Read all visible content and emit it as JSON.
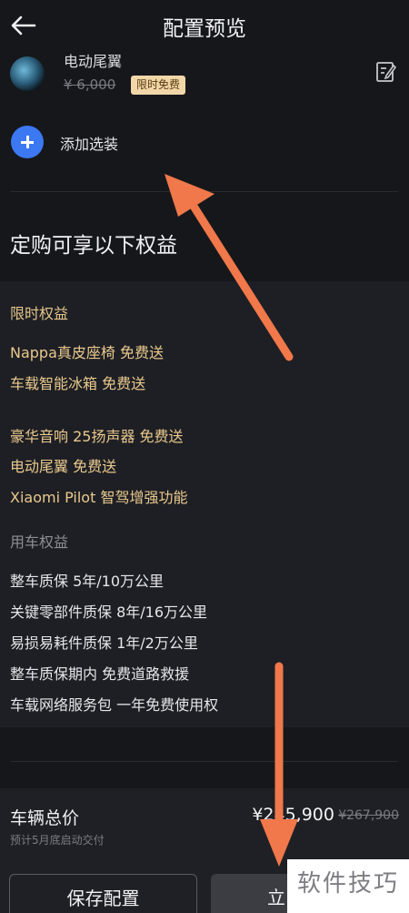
{
  "header": {
    "title": "配置预览",
    "back_icon": "arrow-left-icon"
  },
  "option_item": {
    "name": "电动尾翼",
    "price": "¥ 6,000",
    "badge": "限时免费",
    "icon": "edit-icon"
  },
  "add_option": {
    "label": "添加选装",
    "icon": "plus-circle-icon"
  },
  "benefits": {
    "title": "定购可享以下权益",
    "limited": {
      "title": "限时权益",
      "items": [
        "Nappa真皮座椅 免费送",
        "车载智能冰箱 免费送",
        "豪华音响 25扬声器 免费送",
        "电动尾翼 免费送",
        "Xiaomi Pilot 智驾增强功能"
      ]
    },
    "usage": {
      "title": "用车权益",
      "items": [
        "整车质保 5年/10万公里",
        "关键零部件质保 8年/16万公里",
        "易损易耗件质保 1年/2万公里",
        "整车质保期内 免费道路救援",
        "车载网络服务包 一年免费使用权"
      ]
    }
  },
  "total": {
    "label": "车辆总价",
    "subtitle": "预计5月底启动交付",
    "price": "¥245,900",
    "original_price": "¥267,900"
  },
  "buttons": {
    "save": "保存配置",
    "buy": "立"
  },
  "watermark": "软件技巧",
  "colors": {
    "accent": "#3b78f2",
    "gold": "#e9c98e",
    "badge": "#f1d7a8",
    "annotation_arrow": "#f0784a"
  }
}
